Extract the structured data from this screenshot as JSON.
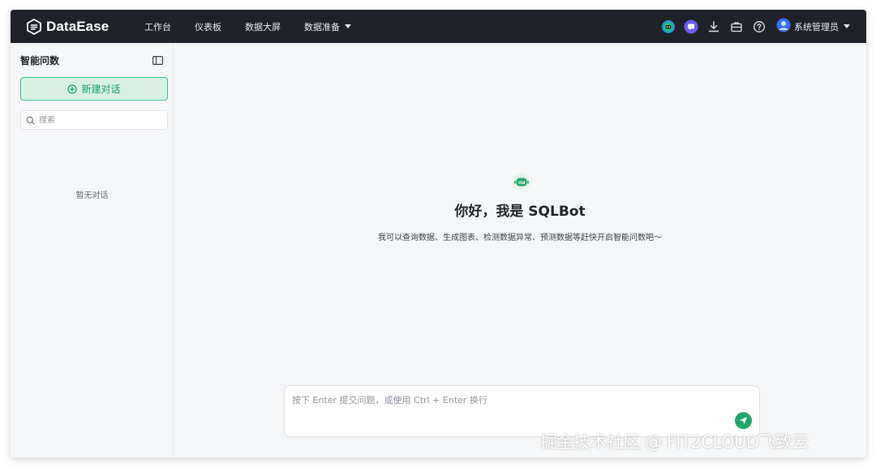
{
  "header": {
    "brand": "DataEase",
    "nav": [
      {
        "label": "工作台"
      },
      {
        "label": "仪表板"
      },
      {
        "label": "数据大屏"
      },
      {
        "label": "数据准备"
      }
    ],
    "icons": [
      "ai-assistant-icon",
      "sqlbot-icon",
      "download-icon",
      "briefcase-icon",
      "help-icon"
    ],
    "user": {
      "name": "系统管理员"
    }
  },
  "sidebar": {
    "title": "智能问数",
    "new_chat_label": "新建对话",
    "search_placeholder": "搜索",
    "empty_text": "暂无对话"
  },
  "main": {
    "welcome_title": "你好，我是 SQLBot",
    "welcome_subtitle": "我可以查询数据、生成图表、检测数据异常、预测数据等赶快开启智能问数吧～",
    "input_placeholder": "按下 Enter 提交问题，或使用 Ctrl + Enter 换行"
  },
  "watermark": "掘金技术社区 @ FIT2CLOUD飞致云",
  "colors": {
    "topbar": "#1f2329",
    "accent": "#20a86b",
    "new_chat_bg": "#d7f2e4",
    "page_bg": "#f5f6f7"
  }
}
